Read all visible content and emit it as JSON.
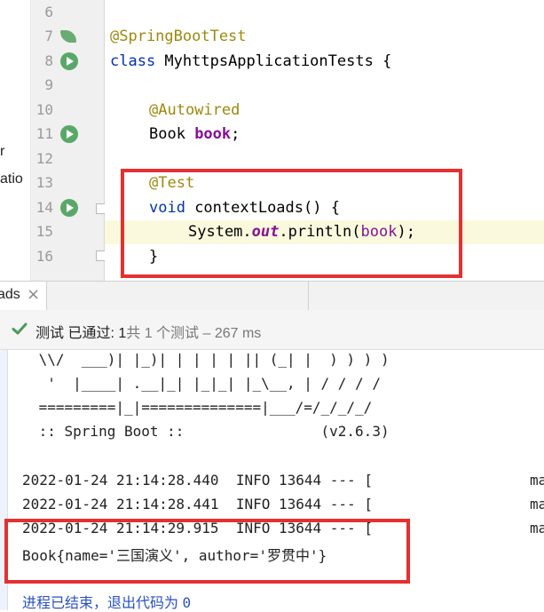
{
  "project_panel": {
    "items": [
      "r",
      "atio"
    ]
  },
  "editor": {
    "line_numbers": [
      "6",
      "7",
      "8",
      "9",
      "10",
      "11",
      "12",
      "13",
      "14",
      "15",
      "16"
    ],
    "lines": {
      "l7": {
        "annotation": "@SpringBootTest"
      },
      "l8": {
        "kw": "class",
        "name": " MyhttpsApplicationTests {"
      },
      "l10": {
        "annotation": "@Autowired"
      },
      "l11": {
        "type": "Book ",
        "field": "book",
        "end": ";"
      },
      "l13": {
        "annotation": "@Test"
      },
      "l14": {
        "kw": "void",
        "rest": " contextLoads() {"
      },
      "l15": {
        "a": "System.",
        "out": "out",
        "b": ".println(",
        "arg": "book",
        "c": ");"
      },
      "l16": {
        "text": "}"
      }
    },
    "gutter_icons": [
      "spring-leaf-icon",
      "run-test-icon",
      "autowired-bean-icon",
      "run-test-icon"
    ]
  },
  "run_window": {
    "tab_label": "ads",
    "tab_close": "×",
    "status": {
      "passed_prefix": "测试 已通过: ",
      "passed_count": "1",
      "total_text": "共 1 个测试",
      "duration": " – 267 ms"
    },
    "console_lines": [
      " \\\\/  ___)| |_)| | | | | || (_| |  ) ) ) )",
      "  '  |____| .__|_| |_|_| |_\\__, | / / / /",
      " =========|_|==============|___/=/_/_/_/",
      " :: Spring Boot ::                (v2.6.3)",
      "2022-01-24 21:14:28.440  INFO 13644 --- [",
      "2022-01-24 21:14:28.441  INFO 13644 --- [",
      "2022-01-24 21:14:29.915  INFO 13644 --- ["
    ],
    "console_right": [
      "ma",
      "ma",
      "ma"
    ],
    "book_output": {
      "a": "Book{name='",
      "name": "三国演义",
      "b": "', author='",
      "author": "罗贯中",
      "c": "'}"
    },
    "exit_text": "进程已结束，退出代码为 ",
    "exit_code": "0"
  },
  "colors": {
    "annotation": "#9e880d",
    "keyword": "#0033b3",
    "field": "#871094",
    "highlight_box": "#e53030",
    "pass_green": "#4c9a5a",
    "exit_blue": "#2a52be"
  }
}
